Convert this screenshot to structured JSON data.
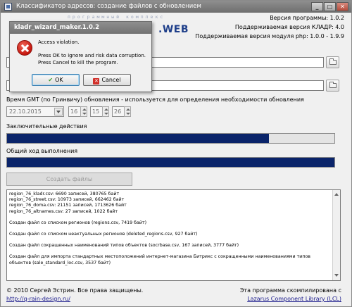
{
  "window": {
    "title": "Классификатор адресов: создание файлов с обновлением",
    "controls": {
      "minimize": "_",
      "maximize": "□",
      "close": "✕"
    }
  },
  "brand": {
    "watermark": "программный комплекс",
    "name": ".WEB"
  },
  "versions": {
    "program": "Версия программы: 1.0.2",
    "kladr": "Поддерживаемая версия КЛАДР: 4.0",
    "php_module": "Поддерживаемая версия модуля php: 1.0.0 - 1.9.9"
  },
  "paths": {
    "field1_value": "",
    "field2_value": ""
  },
  "gmt": {
    "label": "Время GMT (по Гринвичу) обновления - используется для определения необходимости обновления",
    "date": "22.10.2015",
    "hour": "16",
    "minute": "15",
    "second": "26"
  },
  "final_actions": {
    "label": "Заключительные действия",
    "progress_fraction": 0.8
  },
  "overall": {
    "label": "Общий ход выполнения",
    "progress_fraction": 1.0
  },
  "create_button": {
    "label": "Создать файлы",
    "enabled": false
  },
  "log": {
    "lines": [
      "region_76_kladr.csv: 6690 записей, 380765 байт",
      "region_76_street.csv: 10973 записей, 662462 байт",
      "region_76_doma.csv: 21151 записей, 1713626 байт",
      "region_76_altnames.csv: 27 записей, 1022 байт",
      "",
      "Создан файл со списком регионов (regions.csv, 7419 байт)",
      "",
      "Создан файл со списком неактуальных регионов (deleted_regions.csv, 927 байт)",
      "",
      "Создан файл сокращенных наименований типов объектов (socrbase.csv, 167 записей, 3777 байт)",
      "",
      "Создан файл для импорта стандартных местоположений интернет-магазина Битрикс с сокращенными наименованиями типов объектов (sale_standard_loc.csv, 3537 байт)"
    ]
  },
  "footer": {
    "copyright": "© 2010 Сергей Эстрин. Все права защищены.",
    "site_link": "http://q-rain-design.ru/",
    "compiled_text": "Эта программа скомпилирована с",
    "lcl_link": "Lazarus Component Library (LCL)"
  },
  "dialog": {
    "title": "kladr_wizard_maker.1.0.2",
    "icon": "error-icon",
    "message1": "Access violation.",
    "message2": "Press OK to ignore and risk data corruption.",
    "message3": "Press Cancel to kill the program.",
    "ok_label": "OK",
    "cancel_label": "Cancel"
  },
  "colors": {
    "progress": "#0a246a",
    "titlebar": "#7f7f7f",
    "brand": "#1f3f8a"
  }
}
